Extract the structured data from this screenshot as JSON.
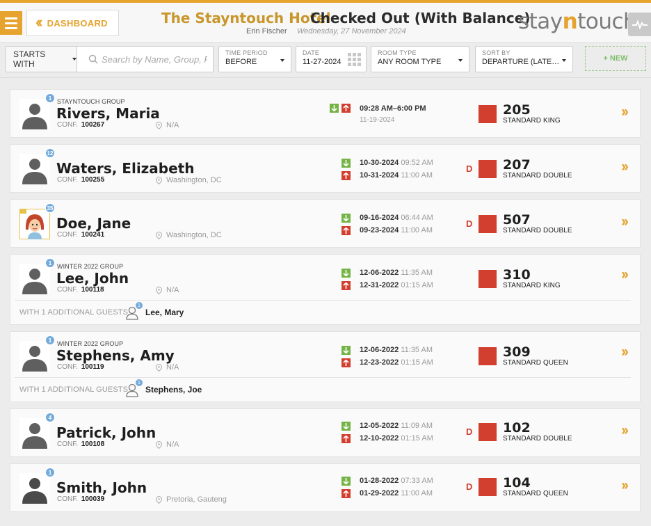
{
  "header": {
    "dashboard_label": "DASHBOARD",
    "hotel_name": "The Stayntouch Hotel",
    "title": "Checked Out (With Balance)",
    "user": "Erin Fischer",
    "business_date": "Wednesday, 27 November 2024",
    "logo_part1": "stay",
    "logo_part2": "n",
    "logo_part3": "touch"
  },
  "filters": {
    "starts_with": "STARTS WITH",
    "search_placeholder": "Search by Name, Group, R",
    "time_period": {
      "label": "TIME PERIOD",
      "value": "BEFORE"
    },
    "date": {
      "label": "DATE",
      "value": "11-27-2024"
    },
    "room_type": {
      "label": "ROOM TYPE",
      "value": "ANY ROOM TYPE"
    },
    "sort_by": {
      "label": "SORT BY",
      "value": "DEPARTURE (LATE…"
    },
    "new_button": "+ NEW"
  },
  "conf_label": "CONF.",
  "additional_label": "WITH 1 ADDITIONAL GUESTS",
  "reservations": [
    {
      "badge": "1",
      "group": "STAYNTOUCH GROUP",
      "name": "Rivers, Maria",
      "conf": "100267",
      "location": "N/A",
      "time_range": "09:28 AM–6:00 PM",
      "day_use_date": "11-19-2024",
      "flag": "",
      "room": "205",
      "room_type": "STANDARD KING"
    },
    {
      "badge": "12",
      "group": "",
      "name": "Waters, Elizabeth",
      "conf": "100255",
      "location": "Washington, DC",
      "arrival_date": "10-30-2024",
      "arrival_time": "09:52 AM",
      "departure_date": "10-31-2024",
      "departure_time": "11:00 AM",
      "flag": "D",
      "room": "207",
      "room_type": "STANDARD DOUBLE"
    },
    {
      "badge": "35",
      "group": "",
      "name": "Doe, Jane",
      "conf": "100241",
      "location": "Washington, DC",
      "arrival_date": "09-16-2024",
      "arrival_time": "06:44 AM",
      "departure_date": "09-23-2024",
      "departure_time": "11:00 AM",
      "flag": "D",
      "room": "507",
      "room_type": "STANDARD DOUBLE"
    },
    {
      "badge": "1",
      "group": "WINTER 2022 GROUP",
      "name": "Lee, John",
      "conf": "100118",
      "location": "N/A",
      "arrival_date": "12-06-2022",
      "arrival_time": "11:35 AM",
      "departure_date": "12-31-2022",
      "departure_time": "01:15 AM",
      "flag": "",
      "room": "310",
      "room_type": "STANDARD KING",
      "additional_guest": "Lee, Mary",
      "additional_badge": "1"
    },
    {
      "badge": "1",
      "group": "WINTER 2022 GROUP",
      "name": "Stephens, Amy",
      "conf": "100119",
      "location": "N/A",
      "arrival_date": "12-06-2022",
      "arrival_time": "11:35 AM",
      "departure_date": "12-23-2022",
      "departure_time": "01:15 AM",
      "flag": "",
      "room": "309",
      "room_type": "STANDARD QUEEN",
      "additional_guest": "Stephens, Joe",
      "additional_badge": "1"
    },
    {
      "badge": "4",
      "group": "",
      "name": "Patrick, John",
      "conf": "100108",
      "location": "N/A",
      "arrival_date": "12-05-2022",
      "arrival_time": "11:09 AM",
      "departure_date": "12-10-2022",
      "departure_time": "01:15 AM",
      "flag": "D",
      "room": "102",
      "room_type": "STANDARD DOUBLE"
    },
    {
      "badge": "1",
      "group": "",
      "name": "Smith, John",
      "conf": "100039",
      "location": "Pretoria, Gauteng",
      "arrival_date": "01-28-2022",
      "arrival_time": "07:33 AM",
      "departure_date": "01-29-2022",
      "departure_time": "11:00 AM",
      "flag": "D",
      "room": "104",
      "room_type": "STANDARD QUEEN"
    }
  ],
  "colors": {
    "accent": "#e6a32e",
    "arrival": "#73b445",
    "departure": "#d23f2f",
    "room_status": "#d23f2f",
    "badge": "#73aadb"
  }
}
